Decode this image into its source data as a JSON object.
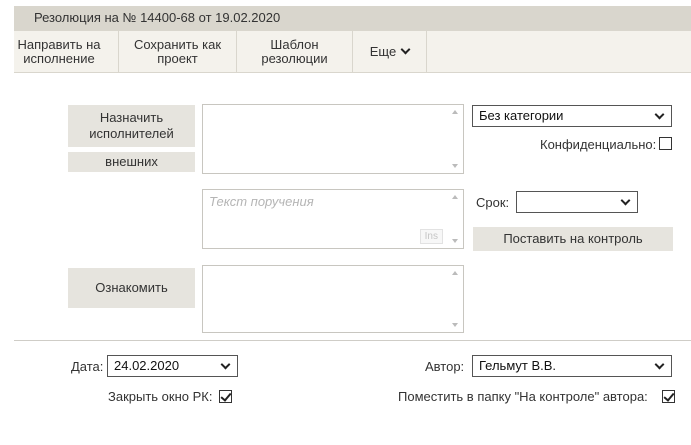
{
  "title": "Резолюция на № 14400-68 от 19.02.2020",
  "toolbar": {
    "send_label": "Направить на\nисполнение",
    "save_draft_label": "Сохранить как\nпроект",
    "template_label": "Шаблон\nрезолюции",
    "more_label": "Еще"
  },
  "assign": {
    "button_label": "Назначить\nисполнителей",
    "external_label": "внешних"
  },
  "category": {
    "value": "Без категории"
  },
  "confidential_label": "Конфиденциально:",
  "confidential_checked": false,
  "task": {
    "placeholder": "Текст поручения",
    "ins_label": "Ins"
  },
  "deadline": {
    "label": "Срок:",
    "value": ""
  },
  "control_button_label": "Поставить на контроль",
  "familiarize_label": "Ознакомить",
  "footer": {
    "date_label": "Дата:",
    "date_value": "24.02.2020",
    "author_label": "Автор:",
    "author_value": "Гельмут В.В.",
    "close_label": "Закрыть окно РК:",
    "close_checked": true,
    "folder_label": "Поместить в папку \"На контроле\" автора:",
    "folder_checked": true
  },
  "icons": [
    "chevron-down-icon",
    "scroll-up-icon",
    "scroll-down-icon",
    "checkmark-icon"
  ]
}
